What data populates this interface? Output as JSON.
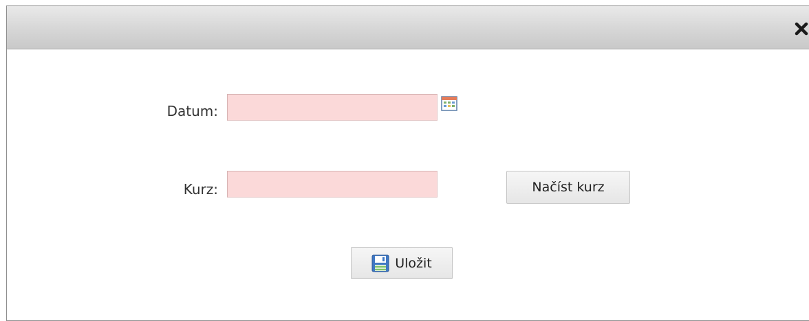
{
  "dialog": {
    "close_icon": "close-icon"
  },
  "form": {
    "date_label": "Datum:",
    "date_value": "",
    "rate_label": "Kurz:",
    "rate_value": "",
    "load_rate_button": "Načíst kurz",
    "save_button": "Uložit",
    "calendar_icon": "calendar-icon",
    "save_icon": "floppy-disk-icon"
  },
  "colors": {
    "invalid_field_bg": "#fbd9d9",
    "titlebar_bg": "#d6d6d6"
  }
}
